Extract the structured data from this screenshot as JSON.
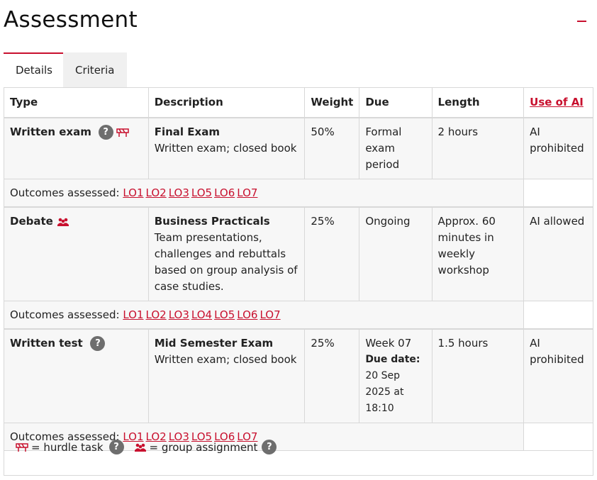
{
  "header": {
    "title": "Assessment"
  },
  "tabs": [
    {
      "label": "Details"
    },
    {
      "label": "Criteria"
    }
  ],
  "table": {
    "headers": {
      "type": "Type",
      "description": "Description",
      "weight": "Weight",
      "due": "Due",
      "length": "Length",
      "ai": "Use of AI"
    },
    "outcomes_label": "Outcomes assessed:",
    "rows": [
      {
        "type": "Written exam",
        "title": "Final Exam",
        "desc": "Written exam; closed book",
        "weight": "50%",
        "due": "Formal exam period",
        "length": "2 hours",
        "ai": "AI prohibited",
        "outcomes": [
          "LO1",
          "LO2",
          "LO3",
          "LO5",
          "LO6",
          "LO7"
        ]
      },
      {
        "type": "Debate",
        "title": "Business Practicals",
        "desc": "Team presentations, challenges and rebuttals based on group analysis of case studies.",
        "weight": "25%",
        "due": "Ongoing",
        "length": "Approx. 60 minutes in weekly workshop",
        "ai": "AI allowed",
        "outcomes": [
          "LO1",
          "LO2",
          "LO3",
          "LO4",
          "LO5",
          "LO6",
          "LO7"
        ]
      },
      {
        "type": "Written test",
        "title": "Mid Semester Exam",
        "desc": "Written exam; closed book",
        "weight": "25%",
        "due": "Week 07",
        "due_date_label": "Due date:",
        "due_date_value": "20 Sep 2025 at 18:10",
        "length": "1.5 hours",
        "ai": "AI prohibited",
        "outcomes": [
          "LO1",
          "LO2",
          "LO3",
          "LO5",
          "LO6",
          "LO7"
        ]
      }
    ]
  },
  "legend": {
    "hurdle": "= hurdle task",
    "group": "= group assignment"
  },
  "help_glyph": "?",
  "icons": {
    "hurdle": "hurdle-icon",
    "group": "group-icon",
    "help": "help-icon",
    "collapse": "minus-icon"
  },
  "colors": {
    "accent": "#c8102e",
    "help_bg": "#6e6e6e",
    "cell_bg": "#f7f7f7",
    "border": "#d8d8d8",
    "tab_inactive": "#f0f0f0"
  }
}
